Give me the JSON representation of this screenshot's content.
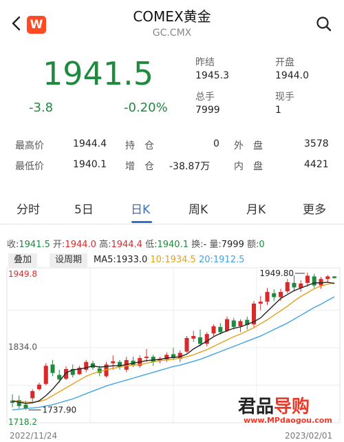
{
  "header": {
    "title": "COMEX黄金",
    "subtitle": "GC.CMX",
    "logo_letter": "W"
  },
  "quote": {
    "price": "1941.5",
    "change": "-3.8",
    "change_pct": "-0.20%",
    "prev_close_label": "昨结",
    "prev_close": "1945.3",
    "open_label": "开盘",
    "open": "1944.0",
    "volume_label": "总手",
    "volume": "7999",
    "current_lot_label": "现手",
    "current_lot": "1"
  },
  "stats": {
    "row1": {
      "high_label": "最高价",
      "high": "1944.4",
      "pos_label": "持　仓",
      "pos": "0",
      "outer_label": "外　盘",
      "outer": "3578"
    },
    "row2": {
      "low_label": "最低价",
      "low": "1940.1",
      "add_label": "增　仓",
      "add": "-38.87万",
      "inner_label": "内　盘",
      "inner": "4421"
    }
  },
  "tabs": [
    "分时",
    "5日",
    "日K",
    "周K",
    "月K",
    "更多"
  ],
  "active_tab": "日K",
  "kinfo": {
    "close_label": "收:",
    "close": "1941.5",
    "open_label": "开:",
    "open": "1944.0",
    "high_label": "高:",
    "high": "1944.4",
    "low_label": "低:",
    "low": "1940.1",
    "turnover_label": "换:",
    "turnover": "-",
    "vol_label": "量:",
    "vol": "7999",
    "amount_label": "额:",
    "amount": "0"
  },
  "toolbar": {
    "overlay_label": "叠加",
    "period_label": "设周期"
  },
  "ma": {
    "ma5_label": "MA5:",
    "ma5": "1933.0",
    "ma10_label": "10:",
    "ma10": "1934.5",
    "ma20_label": "20:",
    "ma20": "1912.5"
  },
  "chart_labels": {
    "y_top": "1949.8",
    "y_mid": "1834.0",
    "y_bottom": "1718.2",
    "max_marker": "1949.80",
    "min_marker": "1737.90",
    "date_start": "2022/11/24",
    "date_end": "2023/02/01"
  },
  "colors": {
    "up": "#d72b2b",
    "down": "#1f8a3e",
    "accent": "#2f6fd6",
    "ma10": "#e3a21a",
    "ma20": "#3fa3e6"
  },
  "chart_data": {
    "type": "candlestick",
    "ylim": [
      1718.2,
      1949.8
    ],
    "y_ticks": [
      1949.8,
      1834.0,
      1718.2
    ],
    "x_range": [
      "2022/11/24",
      "2023/02/01"
    ],
    "candles": [
      {
        "o": 1752,
        "h": 1762,
        "l": 1742,
        "c": 1749
      },
      {
        "o": 1753,
        "h": 1760,
        "l": 1740,
        "c": 1744
      },
      {
        "o": 1746,
        "h": 1752,
        "l": 1738,
        "c": 1740
      },
      {
        "o": 1756,
        "h": 1770,
        "l": 1750,
        "c": 1767
      },
      {
        "o": 1770,
        "h": 1780,
        "l": 1768,
        "c": 1777
      },
      {
        "o": 1778,
        "h": 1810,
        "l": 1776,
        "c": 1806
      },
      {
        "o": 1808,
        "h": 1815,
        "l": 1790,
        "c": 1795
      },
      {
        "o": 1792,
        "h": 1800,
        "l": 1780,
        "c": 1785
      },
      {
        "o": 1786,
        "h": 1805,
        "l": 1784,
        "c": 1801
      },
      {
        "o": 1801,
        "h": 1808,
        "l": 1788,
        "c": 1792
      },
      {
        "o": 1793,
        "h": 1806,
        "l": 1792,
        "c": 1803
      },
      {
        "o": 1800,
        "h": 1815,
        "l": 1796,
        "c": 1812
      },
      {
        "o": 1810,
        "h": 1814,
        "l": 1800,
        "c": 1803
      },
      {
        "o": 1802,
        "h": 1806,
        "l": 1790,
        "c": 1795
      },
      {
        "o": 1790,
        "h": 1812,
        "l": 1788,
        "c": 1808
      },
      {
        "o": 1810,
        "h": 1822,
        "l": 1800,
        "c": 1813
      },
      {
        "o": 1812,
        "h": 1815,
        "l": 1800,
        "c": 1804
      },
      {
        "o": 1800,
        "h": 1820,
        "l": 1796,
        "c": 1815
      },
      {
        "o": 1814,
        "h": 1820,
        "l": 1804,
        "c": 1807
      },
      {
        "o": 1806,
        "h": 1822,
        "l": 1803,
        "c": 1818
      },
      {
        "o": 1818,
        "h": 1832,
        "l": 1812,
        "c": 1820
      },
      {
        "o": 1820,
        "h": 1823,
        "l": 1806,
        "c": 1812
      },
      {
        "o": 1814,
        "h": 1820,
        "l": 1810,
        "c": 1817
      },
      {
        "o": 1816,
        "h": 1827,
        "l": 1812,
        "c": 1823
      },
      {
        "o": 1824,
        "h": 1834,
        "l": 1815,
        "c": 1818
      },
      {
        "o": 1817,
        "h": 1830,
        "l": 1812,
        "c": 1826
      },
      {
        "o": 1828,
        "h": 1852,
        "l": 1826,
        "c": 1849
      },
      {
        "o": 1848,
        "h": 1860,
        "l": 1843,
        "c": 1852
      },
      {
        "o": 1850,
        "h": 1862,
        "l": 1836,
        "c": 1840
      },
      {
        "o": 1840,
        "h": 1858,
        "l": 1836,
        "c": 1855
      },
      {
        "o": 1856,
        "h": 1870,
        "l": 1852,
        "c": 1867
      },
      {
        "o": 1866,
        "h": 1872,
        "l": 1854,
        "c": 1858
      },
      {
        "o": 1860,
        "h": 1882,
        "l": 1858,
        "c": 1878
      },
      {
        "o": 1876,
        "h": 1880,
        "l": 1862,
        "c": 1866
      },
      {
        "o": 1867,
        "h": 1878,
        "l": 1858,
        "c": 1875
      },
      {
        "o": 1877,
        "h": 1882,
        "l": 1862,
        "c": 1869
      },
      {
        "o": 1870,
        "h": 1906,
        "l": 1866,
        "c": 1902
      },
      {
        "o": 1902,
        "h": 1914,
        "l": 1892,
        "c": 1905
      },
      {
        "o": 1905,
        "h": 1926,
        "l": 1900,
        "c": 1920
      },
      {
        "o": 1918,
        "h": 1924,
        "l": 1906,
        "c": 1912
      },
      {
        "o": 1912,
        "h": 1925,
        "l": 1906,
        "c": 1920
      },
      {
        "o": 1921,
        "h": 1940,
        "l": 1918,
        "c": 1935
      },
      {
        "o": 1934,
        "h": 1946,
        "l": 1922,
        "c": 1927
      },
      {
        "o": 1926,
        "h": 1938,
        "l": 1920,
        "c": 1933
      },
      {
        "o": 1934,
        "h": 1949.8,
        "l": 1928,
        "c": 1945
      },
      {
        "o": 1944,
        "h": 1948,
        "l": 1926,
        "c": 1930
      },
      {
        "o": 1930,
        "h": 1943,
        "l": 1925,
        "c": 1940
      },
      {
        "o": 1940,
        "h": 1946,
        "l": 1934,
        "c": 1944
      },
      {
        "o": 1944,
        "h": 1944.4,
        "l": 1940.1,
        "c": 1941.5
      }
    ],
    "ma5": [
      1752,
      1750,
      1748,
      1749,
      1752,
      1760,
      1770,
      1782,
      1795,
      1800,
      1801,
      1803,
      1806,
      1804,
      1805,
      1806,
      1806,
      1808,
      1810,
      1812,
      1814,
      1815,
      1816,
      1818,
      1819,
      1820,
      1824,
      1832,
      1838,
      1844,
      1851,
      1856,
      1860,
      1864,
      1866,
      1870,
      1874,
      1880,
      1890,
      1900,
      1910,
      1916,
      1922,
      1926,
      1930,
      1934,
      1934,
      1935,
      1933
    ],
    "ma10": [
      1752,
      1751,
      1750,
      1750,
      1751,
      1754,
      1760,
      1766,
      1772,
      1778,
      1784,
      1790,
      1794,
      1797,
      1800,
      1802,
      1804,
      1806,
      1807,
      1808,
      1810,
      1812,
      1814,
      1815,
      1816,
      1818,
      1820,
      1823,
      1827,
      1831,
      1836,
      1841,
      1846,
      1851,
      1855,
      1860,
      1865,
      1871,
      1877,
      1884,
      1891,
      1898,
      1906,
      1913,
      1919,
      1925,
      1929,
      1932,
      1934.5
    ],
    "ma20": [
      1738,
      1739,
      1740,
      1741,
      1742,
      1744,
      1746,
      1749,
      1752,
      1755,
      1759,
      1763,
      1767,
      1771,
      1775,
      1778,
      1781,
      1784,
      1787,
      1790,
      1793,
      1796,
      1799,
      1802,
      1805,
      1807,
      1810,
      1813,
      1816,
      1820,
      1824,
      1828,
      1832,
      1836,
      1840,
      1844,
      1848,
      1852,
      1857,
      1862,
      1867,
      1872,
      1878,
      1884,
      1890,
      1896,
      1901,
      1907,
      1912.5
    ]
  }
}
